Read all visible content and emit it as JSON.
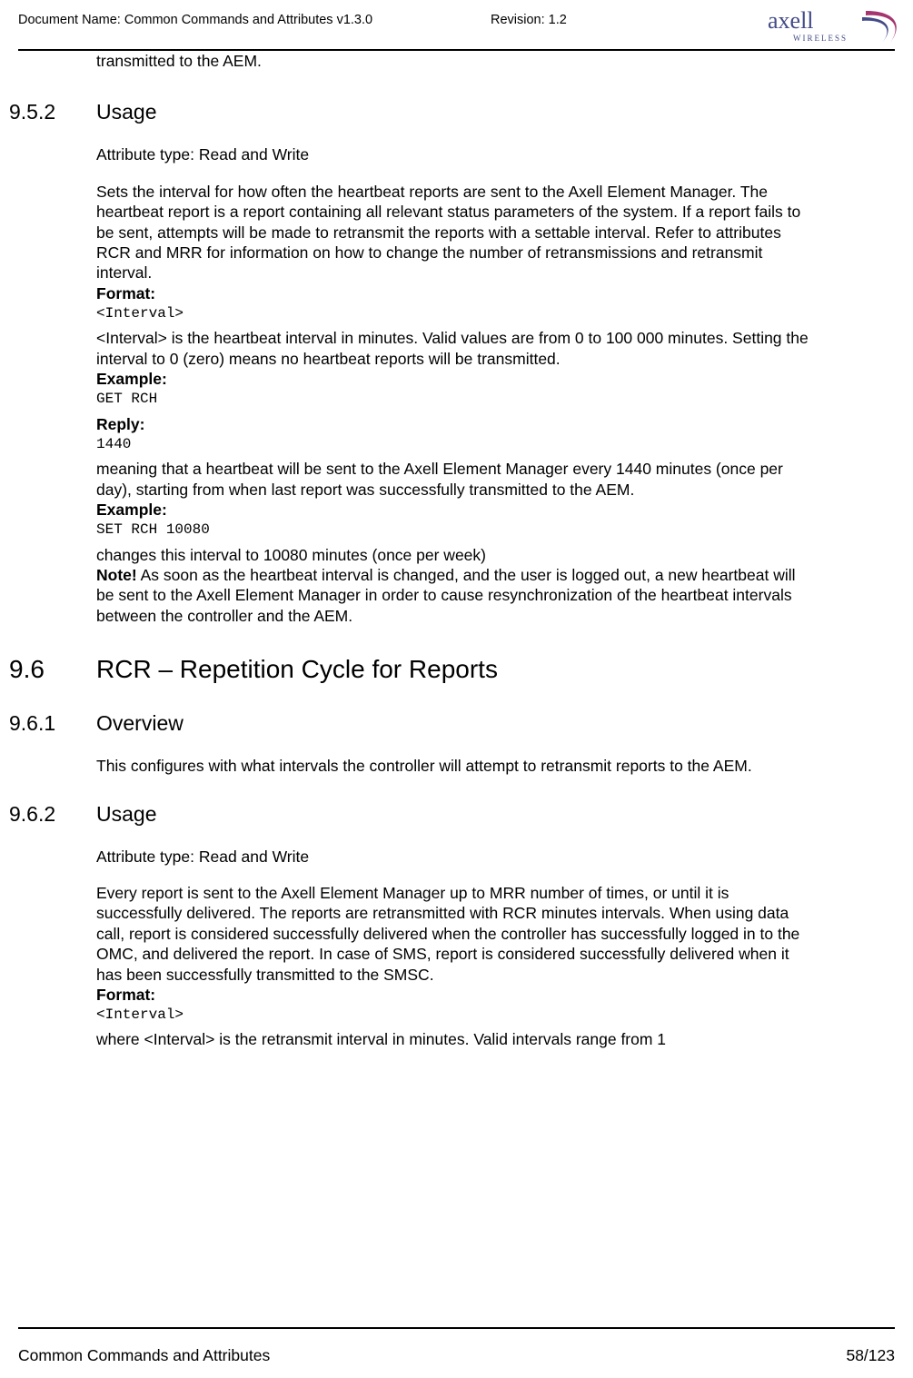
{
  "header": {
    "doc_name": "Document Name: Common Commands and Attributes v1.3.0",
    "revision": "Revision: 1.2",
    "logo_brand": "axell",
    "logo_sub": "WIRELESS"
  },
  "intro_fragment": "transmitted to the AEM.",
  "s952": {
    "num": "9.5.2",
    "title": "Usage",
    "attr_type": "Attribute type: Read and Write",
    "para": "Sets the interval for how often the heartbeat reports are sent to the Axell Element Manager. The heartbeat report is a report containing all relevant status parameters of the system. If a report fails to be sent, attempts will be made to retransmit the reports with a settable interval. Refer to attributes RCR and MRR for information on how to change the number of retransmissions and retransmit interval.",
    "format_label": "Format:",
    "format_code": "<Interval>",
    "interval_para": "<Interval> is the heartbeat interval in minutes. Valid values are from 0 to 100 000 minutes. Setting the interval to 0 (zero) means no heartbeat reports will be transmitted.",
    "example1_label": "Example:",
    "example1_code": "GET RCH",
    "reply_label": "Reply:",
    "reply_code": "1440",
    "reply_para": "meaning that a heartbeat will be sent to the Axell Element Manager every 1440 minutes (once per day), starting from when last report was successfully transmitted to the AEM.",
    "example2_label": "Example:",
    "example2_code": "SET RCH 10080",
    "example2_para": "changes this interval to 10080 minutes (once per week)",
    "note_label": "Note!",
    "note_para": " As soon as the heartbeat interval is changed, and the user is logged out, a new heartbeat will be sent to the Axell Element Manager in order to cause resynchronization of the heartbeat intervals between the controller and the AEM."
  },
  "s96": {
    "num": "9.6",
    "title": "RCR – Repetition Cycle for Reports"
  },
  "s961": {
    "num": "9.6.1",
    "title": "Overview",
    "para": "This configures with what intervals the controller will attempt to retransmit reports to the AEM."
  },
  "s962": {
    "num": "9.6.2",
    "title": "Usage",
    "attr_type": "Attribute type: Read and Write",
    "para": "Every report is sent to the Axell Element Manager up to MRR number of times, or until it is successfully delivered. The reports are retransmitted with RCR minutes intervals. When using data call, report is considered successfully delivered when the controller has successfully logged in to the OMC, and delivered the report. In case of SMS, report is considered successfully delivered when it has been successfully transmitted to the SMSC.",
    "format_label": "Format:",
    "format_code": "<Interval>",
    "interval_para": "where <Interval> is the retransmit interval in minutes. Valid intervals range from 1"
  },
  "footer": {
    "title": "Common Commands and Attributes",
    "page": "58/123"
  }
}
